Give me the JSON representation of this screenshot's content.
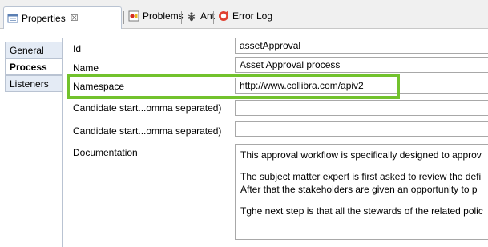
{
  "tabs": [
    {
      "label": "Properties",
      "close": "☒"
    },
    {
      "label": "Problems"
    },
    {
      "label": "Ant"
    },
    {
      "label": "Error Log"
    }
  ],
  "side_tabs": [
    "General",
    "Process",
    "Listeners"
  ],
  "form": {
    "id_label": "Id",
    "id_value": "assetApproval",
    "name_label": "Name",
    "name_value": "Asset Approval process",
    "namespace_label": "Namespace",
    "namespace_value": "http://www.collibra.com/apiv2",
    "candidate1_label": "Candidate start...omma separated)",
    "candidate1_value": "",
    "candidate2_label": "Candidate start...omma separated)",
    "candidate2_value": "",
    "documentation_label": "Documentation",
    "documentation_lines": [
      "This approval workflow is specifically designed to approv",
      "The subject matter expert is first asked to review the defi",
      "After that the stakeholders are given an opportunity to p",
      "Tghe next step is that all the stewards of the related polic"
    ]
  },
  "colors": {
    "highlight": "#72c22d"
  }
}
